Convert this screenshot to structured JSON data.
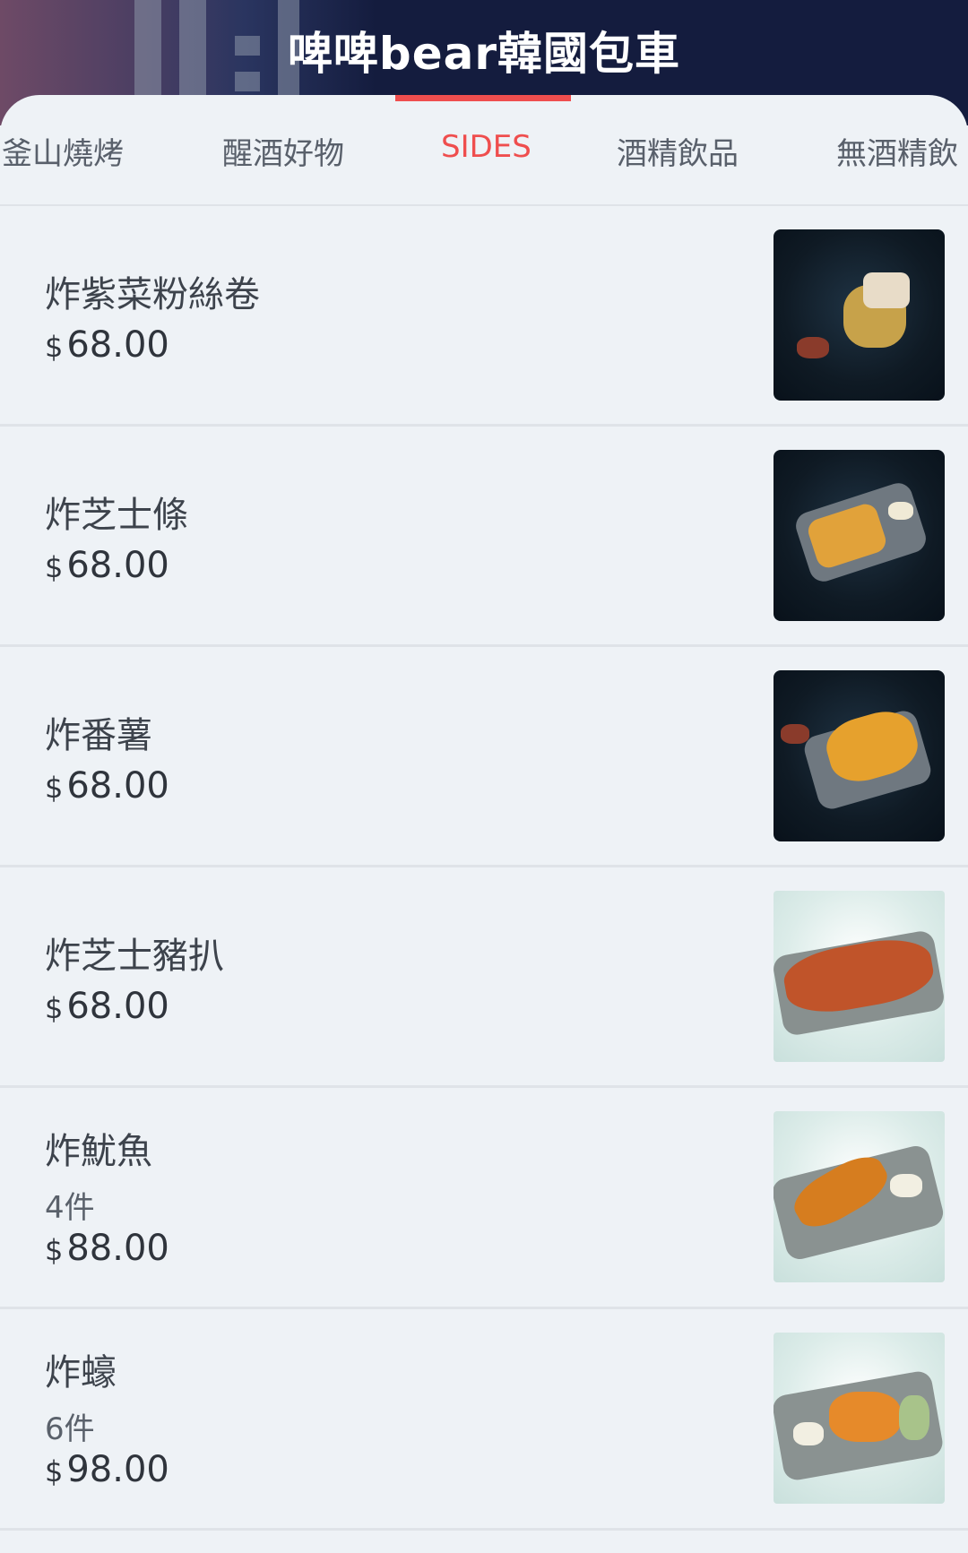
{
  "header": {
    "title": "啤啤bear韓國包車"
  },
  "tabs": [
    {
      "label": "釜山燒烤",
      "active": false
    },
    {
      "label": "醒酒好物",
      "active": false
    },
    {
      "label": "SIDES",
      "active": true
    },
    {
      "label": "酒精飲品",
      "active": false
    },
    {
      "label": "無酒精飲",
      "active": false
    }
  ],
  "colors": {
    "accent": "#ef4e4e",
    "header_bg": "#141c3e",
    "page_bg": "#eef2f6"
  },
  "currency_symbol": "$",
  "items": [
    {
      "name": "炸紫菜粉絲卷",
      "qty": "",
      "price": "68.00",
      "image": "fried-seaweed-rolls-photo"
    },
    {
      "name": "炸芝士條",
      "qty": "",
      "price": "68.00",
      "image": "fried-cheese-sticks-photo"
    },
    {
      "name": "炸番薯",
      "qty": "",
      "price": "68.00",
      "image": "fried-sweet-potato-photo"
    },
    {
      "name": "炸芝士豬扒",
      "qty": "",
      "price": "68.00",
      "image": "fried-cheese-pork-cutlet-photo"
    },
    {
      "name": "炸魷魚",
      "qty": "4件",
      "price": "88.00",
      "image": "fried-squid-photo"
    },
    {
      "name": "炸蠔",
      "qty": "6件",
      "price": "98.00",
      "image": "fried-oysters-photo"
    }
  ]
}
